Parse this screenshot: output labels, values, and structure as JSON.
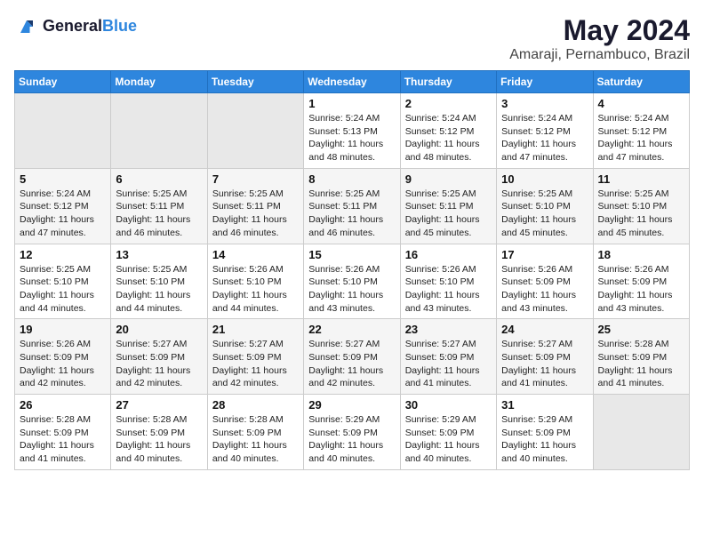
{
  "logo": {
    "text_general": "General",
    "text_blue": "Blue"
  },
  "title": "May 2024",
  "subtitle": "Amaraji, Pernambuco, Brazil",
  "days_header": [
    "Sunday",
    "Monday",
    "Tuesday",
    "Wednesday",
    "Thursday",
    "Friday",
    "Saturday"
  ],
  "weeks": [
    [
      {
        "day": "",
        "info": ""
      },
      {
        "day": "",
        "info": ""
      },
      {
        "day": "",
        "info": ""
      },
      {
        "day": "1",
        "info": "Sunrise: 5:24 AM\nSunset: 5:13 PM\nDaylight: 11 hours\nand 48 minutes."
      },
      {
        "day": "2",
        "info": "Sunrise: 5:24 AM\nSunset: 5:12 PM\nDaylight: 11 hours\nand 48 minutes."
      },
      {
        "day": "3",
        "info": "Sunrise: 5:24 AM\nSunset: 5:12 PM\nDaylight: 11 hours\nand 47 minutes."
      },
      {
        "day": "4",
        "info": "Sunrise: 5:24 AM\nSunset: 5:12 PM\nDaylight: 11 hours\nand 47 minutes."
      }
    ],
    [
      {
        "day": "5",
        "info": "Sunrise: 5:24 AM\nSunset: 5:12 PM\nDaylight: 11 hours\nand 47 minutes."
      },
      {
        "day": "6",
        "info": "Sunrise: 5:25 AM\nSunset: 5:11 PM\nDaylight: 11 hours\nand 46 minutes."
      },
      {
        "day": "7",
        "info": "Sunrise: 5:25 AM\nSunset: 5:11 PM\nDaylight: 11 hours\nand 46 minutes."
      },
      {
        "day": "8",
        "info": "Sunrise: 5:25 AM\nSunset: 5:11 PM\nDaylight: 11 hours\nand 46 minutes."
      },
      {
        "day": "9",
        "info": "Sunrise: 5:25 AM\nSunset: 5:11 PM\nDaylight: 11 hours\nand 45 minutes."
      },
      {
        "day": "10",
        "info": "Sunrise: 5:25 AM\nSunset: 5:10 PM\nDaylight: 11 hours\nand 45 minutes."
      },
      {
        "day": "11",
        "info": "Sunrise: 5:25 AM\nSunset: 5:10 PM\nDaylight: 11 hours\nand 45 minutes."
      }
    ],
    [
      {
        "day": "12",
        "info": "Sunrise: 5:25 AM\nSunset: 5:10 PM\nDaylight: 11 hours\nand 44 minutes."
      },
      {
        "day": "13",
        "info": "Sunrise: 5:25 AM\nSunset: 5:10 PM\nDaylight: 11 hours\nand 44 minutes."
      },
      {
        "day": "14",
        "info": "Sunrise: 5:26 AM\nSunset: 5:10 PM\nDaylight: 11 hours\nand 44 minutes."
      },
      {
        "day": "15",
        "info": "Sunrise: 5:26 AM\nSunset: 5:10 PM\nDaylight: 11 hours\nand 43 minutes."
      },
      {
        "day": "16",
        "info": "Sunrise: 5:26 AM\nSunset: 5:10 PM\nDaylight: 11 hours\nand 43 minutes."
      },
      {
        "day": "17",
        "info": "Sunrise: 5:26 AM\nSunset: 5:09 PM\nDaylight: 11 hours\nand 43 minutes."
      },
      {
        "day": "18",
        "info": "Sunrise: 5:26 AM\nSunset: 5:09 PM\nDaylight: 11 hours\nand 43 minutes."
      }
    ],
    [
      {
        "day": "19",
        "info": "Sunrise: 5:26 AM\nSunset: 5:09 PM\nDaylight: 11 hours\nand 42 minutes."
      },
      {
        "day": "20",
        "info": "Sunrise: 5:27 AM\nSunset: 5:09 PM\nDaylight: 11 hours\nand 42 minutes."
      },
      {
        "day": "21",
        "info": "Sunrise: 5:27 AM\nSunset: 5:09 PM\nDaylight: 11 hours\nand 42 minutes."
      },
      {
        "day": "22",
        "info": "Sunrise: 5:27 AM\nSunset: 5:09 PM\nDaylight: 11 hours\nand 42 minutes."
      },
      {
        "day": "23",
        "info": "Sunrise: 5:27 AM\nSunset: 5:09 PM\nDaylight: 11 hours\nand 41 minutes."
      },
      {
        "day": "24",
        "info": "Sunrise: 5:27 AM\nSunset: 5:09 PM\nDaylight: 11 hours\nand 41 minutes."
      },
      {
        "day": "25",
        "info": "Sunrise: 5:28 AM\nSunset: 5:09 PM\nDaylight: 11 hours\nand 41 minutes."
      }
    ],
    [
      {
        "day": "26",
        "info": "Sunrise: 5:28 AM\nSunset: 5:09 PM\nDaylight: 11 hours\nand 41 minutes."
      },
      {
        "day": "27",
        "info": "Sunrise: 5:28 AM\nSunset: 5:09 PM\nDaylight: 11 hours\nand 40 minutes."
      },
      {
        "day": "28",
        "info": "Sunrise: 5:28 AM\nSunset: 5:09 PM\nDaylight: 11 hours\nand 40 minutes."
      },
      {
        "day": "29",
        "info": "Sunrise: 5:29 AM\nSunset: 5:09 PM\nDaylight: 11 hours\nand 40 minutes."
      },
      {
        "day": "30",
        "info": "Sunrise: 5:29 AM\nSunset: 5:09 PM\nDaylight: 11 hours\nand 40 minutes."
      },
      {
        "day": "31",
        "info": "Sunrise: 5:29 AM\nSunset: 5:09 PM\nDaylight: 11 hours\nand 40 minutes."
      },
      {
        "day": "",
        "info": ""
      }
    ]
  ]
}
